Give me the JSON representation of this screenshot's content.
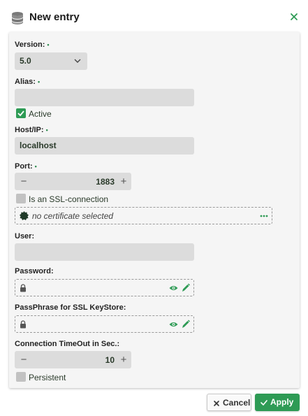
{
  "dialog": {
    "title": "New entry",
    "icons": {
      "header": "database-icon",
      "close": "close-icon"
    }
  },
  "form": {
    "version": {
      "label": "Version:",
      "required_mark": "•",
      "value": "5.0"
    },
    "alias": {
      "label": "Alias:",
      "required_mark": "•",
      "value": ""
    },
    "active": {
      "label": "Active",
      "checked": true
    },
    "host": {
      "label": "Host/IP:",
      "required_mark": "•",
      "value": "localhost"
    },
    "port": {
      "label": "Port:",
      "required_mark": "•",
      "value": "1883",
      "minus": "−",
      "plus": "+"
    },
    "ssl": {
      "label": "Is an SSL-connection",
      "checked": false
    },
    "certificate": {
      "placeholder": "no certificate selected"
    },
    "user": {
      "label": "User:",
      "value": ""
    },
    "password": {
      "label": "Password:",
      "value": ""
    },
    "passphrase": {
      "label": "PassPhrase for SSL KeyStore:",
      "value": ""
    },
    "timeout": {
      "label": "Connection TimeOut in Sec.:",
      "value": "10",
      "minus": "−",
      "plus": "+"
    },
    "persistent": {
      "label": "Persistent",
      "checked": false
    }
  },
  "buttons": {
    "cancel": "Cancel",
    "apply": "Apply"
  },
  "colors": {
    "accent": "#2e9b55",
    "field_bg": "#dcdcdc",
    "panel_bg": "#f5f5f5"
  }
}
